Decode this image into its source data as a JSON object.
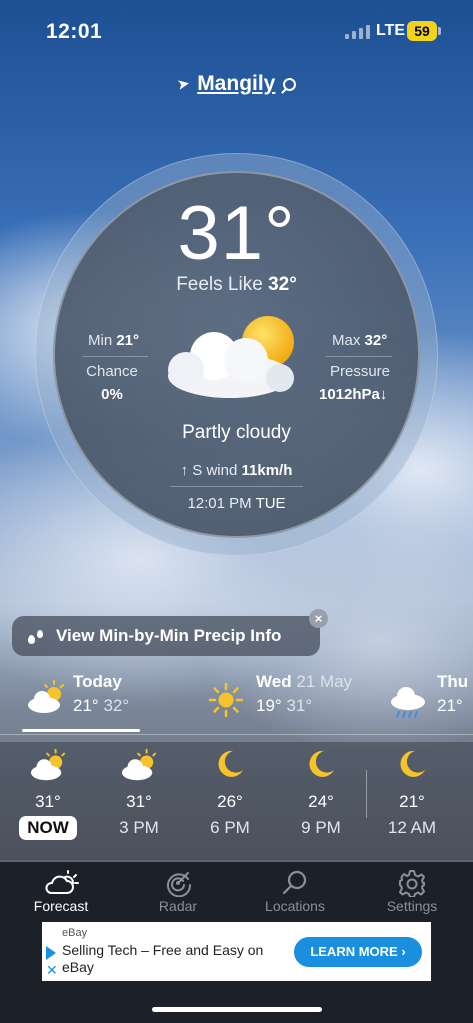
{
  "status_bar": {
    "time": "12:01",
    "network": "LTE",
    "battery": "59"
  },
  "location": {
    "name": "Mangily"
  },
  "current": {
    "temperature": "31°",
    "feels_like_label": "Feels Like",
    "feels_like_value": "32°",
    "min_label": "Min",
    "min_value": "21°",
    "max_label": "Max",
    "max_value": "32°",
    "chance_label": "Chance",
    "chance_value": "0%",
    "pressure_label": "Pressure",
    "pressure_value": "1012hPa↓",
    "condition": "Partly cloudy",
    "wind_prefix": "↑ S wind",
    "wind_speed": "11km/h",
    "updated_time": "12:01 PM",
    "updated_day": "TUE",
    "icon": "partly-cloudy-icon"
  },
  "precip_banner": {
    "label": "View Min-by-Min Precip Info",
    "close": "×"
  },
  "days": [
    {
      "name": "Today",
      "date": "",
      "low": "21°",
      "high": "32°",
      "icon": "partly-cloudy-icon"
    },
    {
      "name": "Wed",
      "date": "21 May",
      "low": "19°",
      "high": "31°",
      "icon": "sun-icon"
    },
    {
      "name": "Thu",
      "date": "",
      "low": "21°",
      "high": "",
      "icon": "rain-cloud-icon"
    }
  ],
  "hours": [
    {
      "temp": "31°",
      "label": "NOW",
      "icon": "partly-cloudy-icon"
    },
    {
      "temp": "31°",
      "label": "3 PM",
      "icon": "partly-cloudy-icon"
    },
    {
      "temp": "26°",
      "label": "6 PM",
      "icon": "moon-icon"
    },
    {
      "temp": "24°",
      "label": "9 PM",
      "icon": "moon-icon"
    },
    {
      "temp": "21°",
      "label": "12 AM",
      "icon": "moon-icon"
    }
  ],
  "tabs": [
    {
      "label": "Forecast",
      "icon": "forecast-icon",
      "active": true
    },
    {
      "label": "Radar",
      "icon": "radar-icon",
      "active": false
    },
    {
      "label": "Locations",
      "icon": "search-icon",
      "active": false
    },
    {
      "label": "Settings",
      "icon": "gear-icon",
      "active": false
    }
  ],
  "ad": {
    "brand": "eBay",
    "title": "Selling Tech – Free and Easy on eBay",
    "cta": "LEARN MORE"
  },
  "colors": {
    "sun": "#f6c42a",
    "moon": "#f6c42a",
    "ad_cta": "#1a8fe0",
    "battery": "#f3d21a",
    "tab_bar": "#1b2029"
  }
}
